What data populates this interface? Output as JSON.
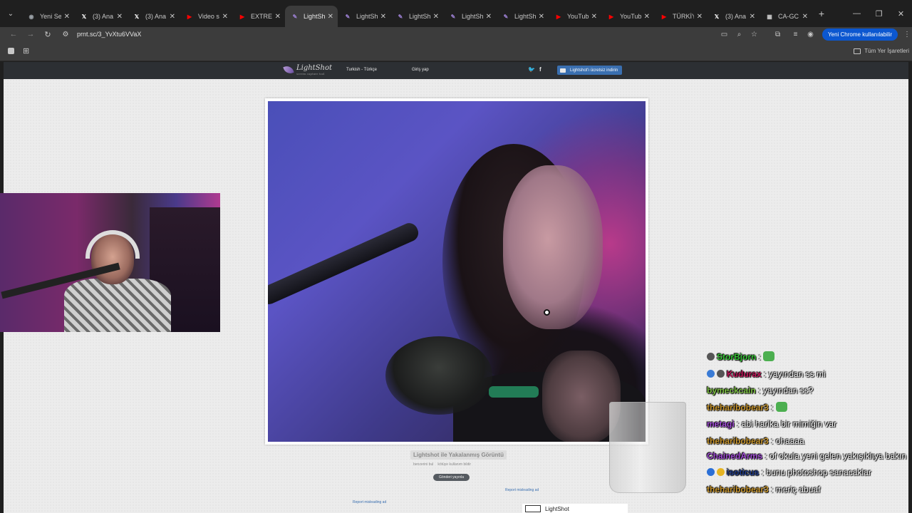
{
  "browser": {
    "tabs": [
      {
        "title": "Yeni Se",
        "favicon": "chrome-icon",
        "fav_color": "#9aa0a6",
        "active": false
      },
      {
        "title": "(3) Ana",
        "favicon": "x-icon",
        "fav_color": "#ffffff",
        "active": false
      },
      {
        "title": "(3) Ana",
        "favicon": "x-icon",
        "fav_color": "#ffffff",
        "active": false
      },
      {
        "title": "Video s",
        "favicon": "youtube-icon",
        "fav_color": "#ff0000",
        "active": false
      },
      {
        "title": "EXTREM",
        "favicon": "youtube-icon",
        "fav_color": "#ff0000",
        "active": false
      },
      {
        "title": "LightSh",
        "favicon": "lightshot-icon",
        "fav_color": "#9b7fd1",
        "active": true
      },
      {
        "title": "LightSh",
        "favicon": "lightshot-icon",
        "fav_color": "#9b7fd1",
        "active": false
      },
      {
        "title": "LightSh",
        "favicon": "lightshot-icon",
        "fav_color": "#9b7fd1",
        "active": false
      },
      {
        "title": "LightSh",
        "favicon": "lightshot-icon",
        "fav_color": "#9b7fd1",
        "active": false
      },
      {
        "title": "LightSh",
        "favicon": "lightshot-icon",
        "fav_color": "#9b7fd1",
        "active": false
      },
      {
        "title": "YouTub",
        "favicon": "youtube-icon",
        "fav_color": "#ff0000",
        "active": false
      },
      {
        "title": "YouTub",
        "favicon": "youtube-icon",
        "fav_color": "#ff0000",
        "active": false
      },
      {
        "title": "TÜRKİY",
        "favicon": "youtube-icon",
        "fav_color": "#ff0000",
        "active": false
      },
      {
        "title": "(3) Ana",
        "favicon": "x-icon",
        "fav_color": "#ffffff",
        "active": false
      },
      {
        "title": "CA-GC",
        "favicon": "page-icon",
        "fav_color": "#c7c7c7",
        "active": false
      }
    ],
    "url": "prnt.sc/3_YvXtu6VVaX",
    "update_pill": "Yeni Chrome kullanılabilir",
    "bookmarks_folder": "Tüm Yer İşaretleri"
  },
  "lightshot": {
    "logo": "LightShot",
    "logo_tagline": "screen capture tool",
    "language": "Turkish - Türkçe",
    "login": "Giriş yap",
    "download_btn": "Lightshot'ı ücretsiz indirin",
    "caption": "Lightshot ile Yakalanmış Görüntü",
    "similar_link": "benzerini bul",
    "report_link": "kötüye kullanım bildir",
    "tweet_btn": "Gönderi yayınla",
    "ad_report_1": "Report misleading ad",
    "ad_report_2": "Report misleading ad",
    "card_title": "LightShot"
  },
  "chat": [
    {
      "user": "StorBjorn",
      "color": "#36c436",
      "msg": "",
      "badges": [
        "#555555"
      ],
      "emote": true
    },
    {
      "user": "Kudurax",
      "color": "#c2185b",
      "msg": "yayından ss mi",
      "badges": [
        "#3a7bd5",
        "#555555"
      ],
      "emote": false
    },
    {
      "user": "bymeckcain",
      "color": "#7cc042",
      "msg": "yayından ss?",
      "badges": [],
      "emote": false
    },
    {
      "user": "theharibobear3",
      "color": "#c8962e",
      "msg": "",
      "badges": [],
      "emote": true
    },
    {
      "user": "metagi",
      "color": "#a14cd6",
      "msg": "abi harika bir mimiğin var",
      "badges": [],
      "emote": false
    },
    {
      "user": "theharibobear3",
      "color": "#c8962e",
      "msg": "ohaaaa",
      "badges": [],
      "emote": false
    },
    {
      "user": "ChainedArms",
      "color": "#a14cd6",
      "msg": "of okula yeni gelen yakışıklıya bakın",
      "badges": [],
      "emote": false,
      "wrap": true
    },
    {
      "user": "isoticus",
      "color": "#1e3a8a",
      "msg": "bunu photoshop sanacaklar",
      "badges": [
        "#2b6fd6",
        "#e6b422"
      ],
      "emote": false
    },
    {
      "user": "theharibobear3",
      "color": "#c8962e",
      "msg": "meriç abuaf",
      "badges": [],
      "emote": false
    }
  ]
}
